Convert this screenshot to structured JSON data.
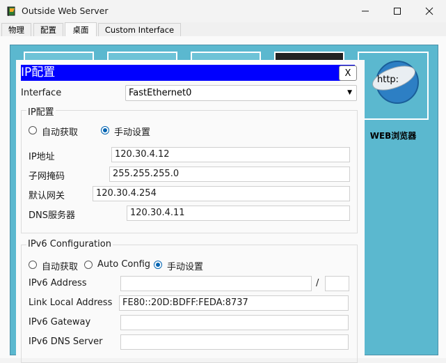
{
  "window": {
    "title": "Outside Web Server",
    "controls": [
      "minimize-icon",
      "maximize-icon",
      "close-icon"
    ]
  },
  "tabs": [
    {
      "label": "物理",
      "active": false
    },
    {
      "label": "配置",
      "active": false
    },
    {
      "label": "桌面",
      "active": true
    },
    {
      "label": "Custom Interface",
      "active": false
    }
  ],
  "desktop": {
    "browser_label": "WEB浏览器",
    "browser_icon_text": "http:"
  },
  "dialog": {
    "title": "IP配置",
    "close_label": "X",
    "interface_label": "Interface",
    "interface_value": "FastEthernet0",
    "ipv4": {
      "legend": "IP配置",
      "radio_auto": "自动获取",
      "radio_manual": "手动设置",
      "selected": "manual",
      "ip_label": "IP地址",
      "ip_value": "120.30.4.12",
      "mask_label": "子网掩码",
      "mask_value": "255.255.255.0",
      "gateway_label": "默认网关",
      "gateway_value": "120.30.4.254",
      "dns_label": "DNS服务器",
      "dns_value": "120.30.4.11"
    },
    "ipv6": {
      "legend": "IPv6 Configuration",
      "radio_auto": "自动获取",
      "radio_autoconfig": "Auto Config",
      "radio_manual": "手动设置",
      "selected": "manual",
      "address_label": "IPv6 Address",
      "address_value": "",
      "prefix_separator": "/",
      "prefix_value": "",
      "link_local_label": "Link Local Address",
      "link_local_value": "FE80::20D:BDFF:FEDA:8737",
      "gateway_label": "IPv6 Gateway",
      "gateway_value": "",
      "dns_label": "IPv6 DNS Server",
      "dns_value": ""
    }
  },
  "colors": {
    "dialog_header": "#0000ff",
    "desktop_bg": "#5bb8cf",
    "radio_selected": "#0063b1"
  }
}
